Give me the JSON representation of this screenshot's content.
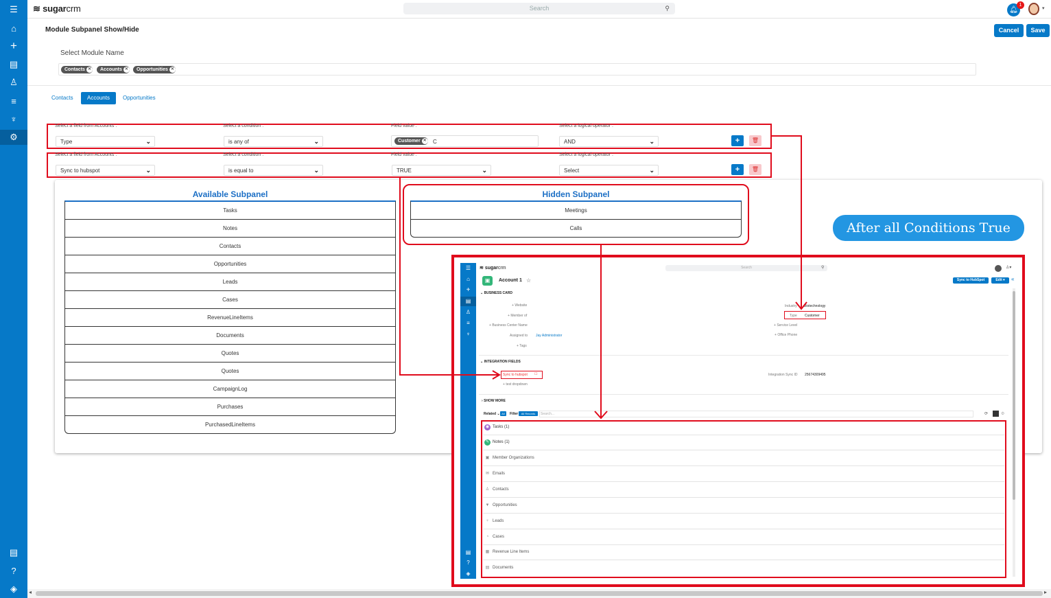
{
  "app": {
    "logo_brand": "sugar",
    "logo_suffix": "crm",
    "search_placeholder": "Search",
    "notification_count": "1"
  },
  "rail": {
    "icons": [
      "menu-icon",
      "home-icon",
      "plus-icon",
      "document-icon",
      "user-icon",
      "filter-icon",
      "trophy-icon",
      "gear-icon"
    ],
    "bottom_icons": [
      "document-icon",
      "help-icon",
      "layers-icon"
    ]
  },
  "header": {
    "title": "Module Subpanel Show/Hide",
    "cancel_label": "Cancel",
    "save_label": "Save"
  },
  "module_select": {
    "label": "Select Module Name",
    "selected": [
      "Contacts",
      "Accounts",
      "Opportunities"
    ]
  },
  "tabs": [
    "Contacts",
    "Accounts",
    "Opportunities"
  ],
  "active_tab": "Accounts",
  "conditions": [
    {
      "field_label": "Select a field from Accounts :",
      "field": "Type",
      "cond_label": "Select a condition :",
      "condition": "is any of",
      "value_label": "Field value :",
      "value_pill": "Customer",
      "value_text": "C",
      "op_label": "Select a logical operator :",
      "operator": "AND"
    },
    {
      "field_label": "Select a field from Accounts :",
      "field": "Sync to hubspot",
      "cond_label": "Select a condition :",
      "condition": "is equal to",
      "value_label": "Field value :",
      "value_select": "TRUE",
      "op_label": "Select a logical operator :",
      "operator": "Select"
    }
  ],
  "available_subpanel": {
    "title": "Available Subpanel",
    "items": [
      "Tasks",
      "Notes",
      "Contacts",
      "Opportunities",
      "Leads",
      "Cases",
      "RevenueLineItems",
      "Documents",
      "Quotes",
      "Quotes",
      "CampaignLog",
      "Purchases",
      "PurchasedLineItems"
    ]
  },
  "hidden_subpanel": {
    "title": "Hidden Subpanel",
    "items": [
      "Meetings",
      "Calls"
    ]
  },
  "banner": "After all Conditions True",
  "inset": {
    "record_name": "Account 1",
    "sync_button": "Sync to HubSpot",
    "edit_button": "Edit",
    "section_business": "BUSINESS CARD",
    "fields_left": [
      "Website",
      "Member of",
      "Business Center Name",
      "Assigned to",
      "Tags"
    ],
    "assigned_to_value": "Jay Administrator",
    "industry_label": "Industry",
    "industry_value": "Biotechnology",
    "type_label": "Type",
    "type_value": "Customer",
    "fields_right": [
      "Service Level",
      "Office Phone"
    ],
    "section_integration": "INTEGRATION FIELDS",
    "sync_field": "Sync to hubspot",
    "test_dropdown": "test dropdown",
    "integration_id_label": "Integration Sync ID",
    "integration_id_value": "25674309495",
    "show_more": "SHOW MORE",
    "related_label": "Related",
    "all_label": "All",
    "filter_label": "Filter",
    "all_records": "All Records",
    "search_placeholder": "Search...",
    "related_rows": [
      "Tasks (1)",
      "Notes (1)",
      "Member Organizations",
      "Emails",
      "Contacts",
      "Opportunities",
      "Leads",
      "Cases",
      "Revenue Line Items",
      "Documents"
    ]
  }
}
